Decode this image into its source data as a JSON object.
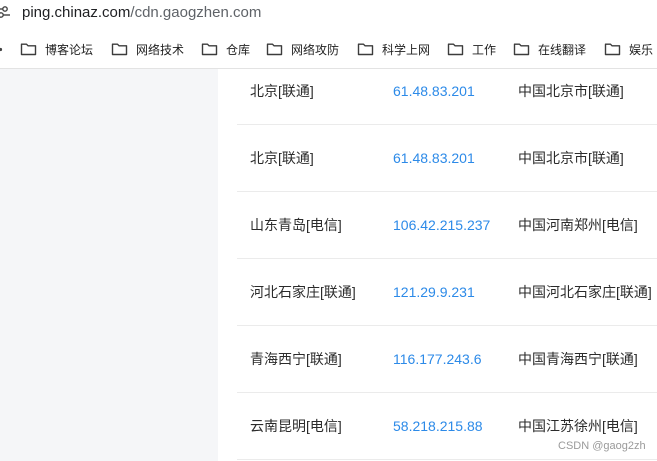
{
  "address_bar": {
    "host": "ping.chinaz.com",
    "path": "/cdn.gaogzhen.com"
  },
  "bookmarks": [
    {
      "label": "博客论坛",
      "icon": "folder-icon"
    },
    {
      "label": "网络技术",
      "icon": "folder-icon"
    },
    {
      "label": "仓库",
      "icon": "folder-icon"
    },
    {
      "label": "网络攻防",
      "icon": "folder-icon"
    },
    {
      "label": "科学上网",
      "icon": "folder-icon"
    },
    {
      "label": "工作",
      "icon": "folder-icon"
    },
    {
      "label": "在线翻译",
      "icon": "folder-icon"
    },
    {
      "label": "娱乐",
      "icon": "folder-icon"
    }
  ],
  "results": [
    {
      "location": "北京[联通]",
      "ip": "61.48.83.201",
      "geo": "中国北京市[联通]"
    },
    {
      "location": "北京[联通]",
      "ip": "61.48.83.201",
      "geo": "中国北京市[联通]"
    },
    {
      "location": "山东青岛[电信]",
      "ip": "106.42.215.237",
      "geo": "中国河南郑州[电信]"
    },
    {
      "location": "河北石家庄[联通]",
      "ip": "121.29.9.231",
      "geo": "中国河北石家庄[联通]"
    },
    {
      "location": "青海西宁[联通]",
      "ip": "116.177.243.6",
      "geo": "中国青海西宁[联通]"
    },
    {
      "location": "云南昆明[电信]",
      "ip": "58.218.215.88",
      "geo": "中国江苏徐州[电信]"
    }
  ],
  "watermark": "CSDN @gaog2zh",
  "colors": {
    "ip_link": "#2c8ae8",
    "panel_bg": "#f5f6f8",
    "divider": "#ebebeb"
  }
}
